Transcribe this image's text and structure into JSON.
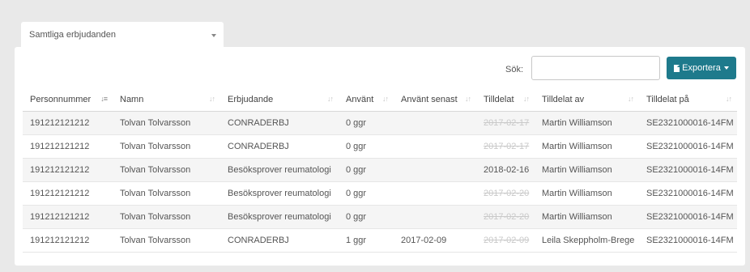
{
  "filter": {
    "selected": "Samtliga erbjudanden"
  },
  "toolbar": {
    "search_label": "Sök:",
    "search_value": "",
    "export_label": "Exportera"
  },
  "table": {
    "columns": [
      "Personnummer",
      "Namn",
      "Erbjudande",
      "Använt",
      "Använt senast",
      "Tilldelat",
      "Tilldelat av",
      "Tilldelat på"
    ],
    "rows": [
      {
        "personnummer": "191212121212",
        "namn": "Tolvan Tolvarsson",
        "erbjudande": "CONRADERBJ",
        "anvant": "0 ggr",
        "anvant_senast": "",
        "tilldelat": "2017-02-17",
        "tilldelat_struck": true,
        "tilldelat_av": "Martin Williamson",
        "tilldelat_pa": "SE2321000016-14FM"
      },
      {
        "personnummer": "191212121212",
        "namn": "Tolvan Tolvarsson",
        "erbjudande": "CONRADERBJ",
        "anvant": "0 ggr",
        "anvant_senast": "",
        "tilldelat": "2017-02-17",
        "tilldelat_struck": true,
        "tilldelat_av": "Martin Williamson",
        "tilldelat_pa": "SE2321000016-14FM"
      },
      {
        "personnummer": "191212121212",
        "namn": "Tolvan Tolvarsson",
        "erbjudande": "Besöksprover reumatologi",
        "anvant": "0 ggr",
        "anvant_senast": "",
        "tilldelat": "2018-02-16",
        "tilldelat_struck": false,
        "tilldelat_av": "Martin Williamson",
        "tilldelat_pa": "SE2321000016-14FM"
      },
      {
        "personnummer": "191212121212",
        "namn": "Tolvan Tolvarsson",
        "erbjudande": "Besöksprover reumatologi",
        "anvant": "0 ggr",
        "anvant_senast": "",
        "tilldelat": "2017-02-20",
        "tilldelat_struck": true,
        "tilldelat_av": "Martin Williamson",
        "tilldelat_pa": "SE2321000016-14FM"
      },
      {
        "personnummer": "191212121212",
        "namn": "Tolvan Tolvarsson",
        "erbjudande": "Besöksprover reumatologi",
        "anvant": "0 ggr",
        "anvant_senast": "",
        "tilldelat": "2017-02-20",
        "tilldelat_struck": true,
        "tilldelat_av": "Martin Williamson",
        "tilldelat_pa": "SE2321000016-14FM"
      },
      {
        "personnummer": "191212121212",
        "namn": "Tolvan Tolvarsson",
        "erbjudande": "CONRADERBJ",
        "anvant": "1 ggr",
        "anvant_senast": "2017-02-09",
        "tilldelat": "2017-02-09",
        "tilldelat_struck": true,
        "tilldelat_av": "Leila Skeppholm-Brege",
        "tilldelat_pa": "SE2321000016-14FM"
      }
    ]
  },
  "colors": {
    "accent": "#1e7a8c",
    "background": "#e9e9e9",
    "stripe": "#f5f5f5"
  }
}
